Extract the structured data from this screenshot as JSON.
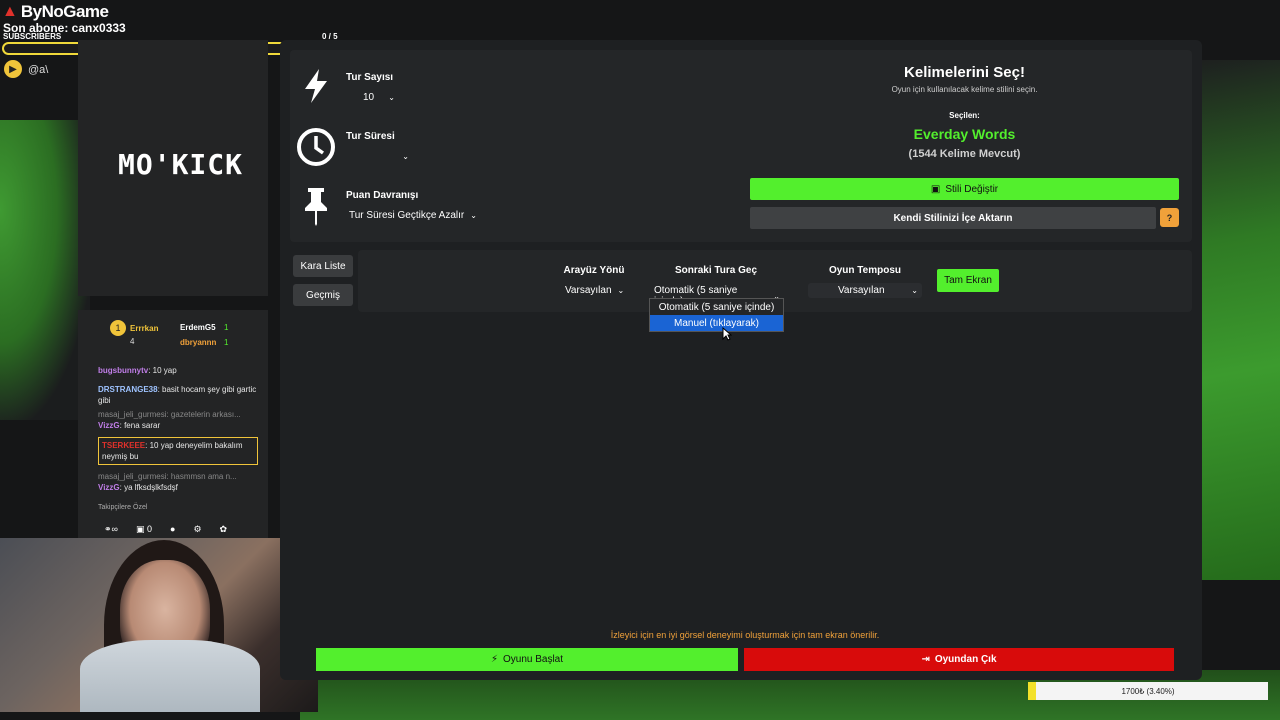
{
  "overlay": {
    "logo": "ByNoGame",
    "last_sub": "Son abone: canx0333",
    "subs_label": "SUBSCRIBERS",
    "subs_count": "0 / 5",
    "handle": "@a\\",
    "side_logo": "MO'KICK"
  },
  "settings": {
    "rounds_label": "Tur Sayısı",
    "rounds_value": "10",
    "time_label": "Tur Süresi",
    "time_value": "",
    "points_label": "Puan Davranışı",
    "points_value": "Tur Süresi Geçtikçe Azalır"
  },
  "words": {
    "title": "Kelimelerini Seç!",
    "subtitle": "Oyun için kullanılacak kelime stilini seçin.",
    "selected_label": "Seçilen:",
    "selected_name": "Everday Words",
    "count": "(1544 Kelime Mevcut)",
    "change_btn": "Stili Değiştir",
    "import_btn": "Kendi Stilinizi İçe Aktarın",
    "help_btn": "?"
  },
  "options": {
    "blacklist_btn": "Kara Liste",
    "history_btn": "Geçmiş",
    "ui_dir_label": "Arayüz Yönü",
    "ui_dir_value": "Varsayılan",
    "next_label": "Sonraki Tura Geç",
    "next_value": "Otomatik (5 saniye içinde)",
    "tempo_label": "Oyun Temposu",
    "tempo_value": "Varsayılan",
    "fullscreen_btn": "Tam Ekran",
    "dropdown_options": [
      "Otomatik (5 saniye içinde)",
      "Manuel (tıklayarak)"
    ]
  },
  "chat": {
    "top": [
      {
        "name": "Errrkan",
        "val": "4"
      },
      {
        "name": "ErdemG5",
        "val": "1"
      },
      {
        "name": "dbryannn",
        "val": "1"
      }
    ],
    "messages": [
      {
        "user": "bugsbunnytv",
        "text": ": 10 yap"
      },
      {
        "user": "DRSTRANGE38",
        "text": ": basit hocam şey gibi gartic gibi"
      },
      {
        "user": "",
        "text": "masaj_jeli_gurmesi: gazetelerin arkası..."
      },
      {
        "user": "VizzG",
        "text": ": fena sarar"
      },
      {
        "user": "TSERKEEE",
        "text": ": 10 yap deneyelim bakalım neymiş bu"
      },
      {
        "user": "",
        "text": "masaj_jeli_gurmesi: hasmmsn ama n..."
      },
      {
        "user": "VizzG",
        "text": ": ya lfksdşlkfsdşf"
      }
    ],
    "footer": "Takipçilere Özel",
    "counter": "0"
  },
  "footer": {
    "note": "İzleyici için en iyi görsel deneyimi oluşturmak için tam ekran önerilir.",
    "start_btn": "Oyunu Başlat",
    "exit_btn": "Oyundan Çık",
    "goal_text": "1700₺ (3.40%)",
    "goal_progress": 0.034
  },
  "colors": {
    "accent_green": "#53ef2d",
    "danger_red": "#d80b0b",
    "selected_blue": "#1a64d4",
    "warning_orange": "#f0a13a"
  }
}
